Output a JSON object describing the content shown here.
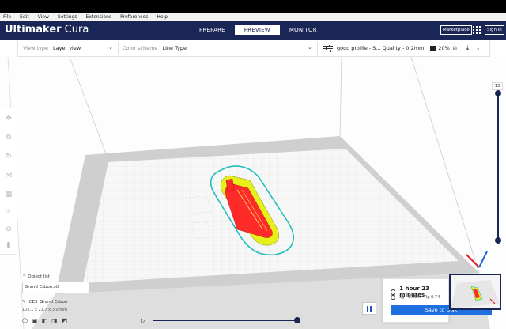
{
  "menu": [
    "File",
    "Edit",
    "View",
    "Settings",
    "Extensions",
    "Preferences",
    "Help"
  ],
  "header": {
    "brand_bold": "Ultimaker",
    "brand_light": " Cura",
    "stages": [
      "PREPARE",
      "PREVIEW",
      "MONITOR"
    ],
    "active_stage": "PREVIEW",
    "marketplace_label": "Marketplace",
    "signin_label": "Sign in"
  },
  "toolbar": {
    "view_type_label": "View type",
    "view_type_value": "Layer view",
    "color_scheme_label": "Color scheme",
    "color_scheme_value": "Line Type",
    "profile": "good profile - S... Quality - 0.2mm",
    "infill": "20%"
  },
  "layer_slider": {
    "current_layer": "13",
    "level": 1.0
  },
  "simulation": {
    "progress": 1.0
  },
  "object_list": {
    "header": "Object list",
    "file_name": "Grand Esboo.stl",
    "object_name": "CE3_Grand Esboo",
    "dimensions": "105.1 x 21.7 x 3.0 mm"
  },
  "print_info": {
    "time": "1 hour 23 minutes",
    "estimate": "3g · 1.15m · Rp 0.74",
    "save_label": "Save to Disk"
  },
  "colors": {
    "header_bg": "#1a2756",
    "accent_blue": "#1e6fe0",
    "wall_outer": "#ff2a2a",
    "wall_inner": "#e8f01a",
    "skirt": "#1fbfbf"
  }
}
